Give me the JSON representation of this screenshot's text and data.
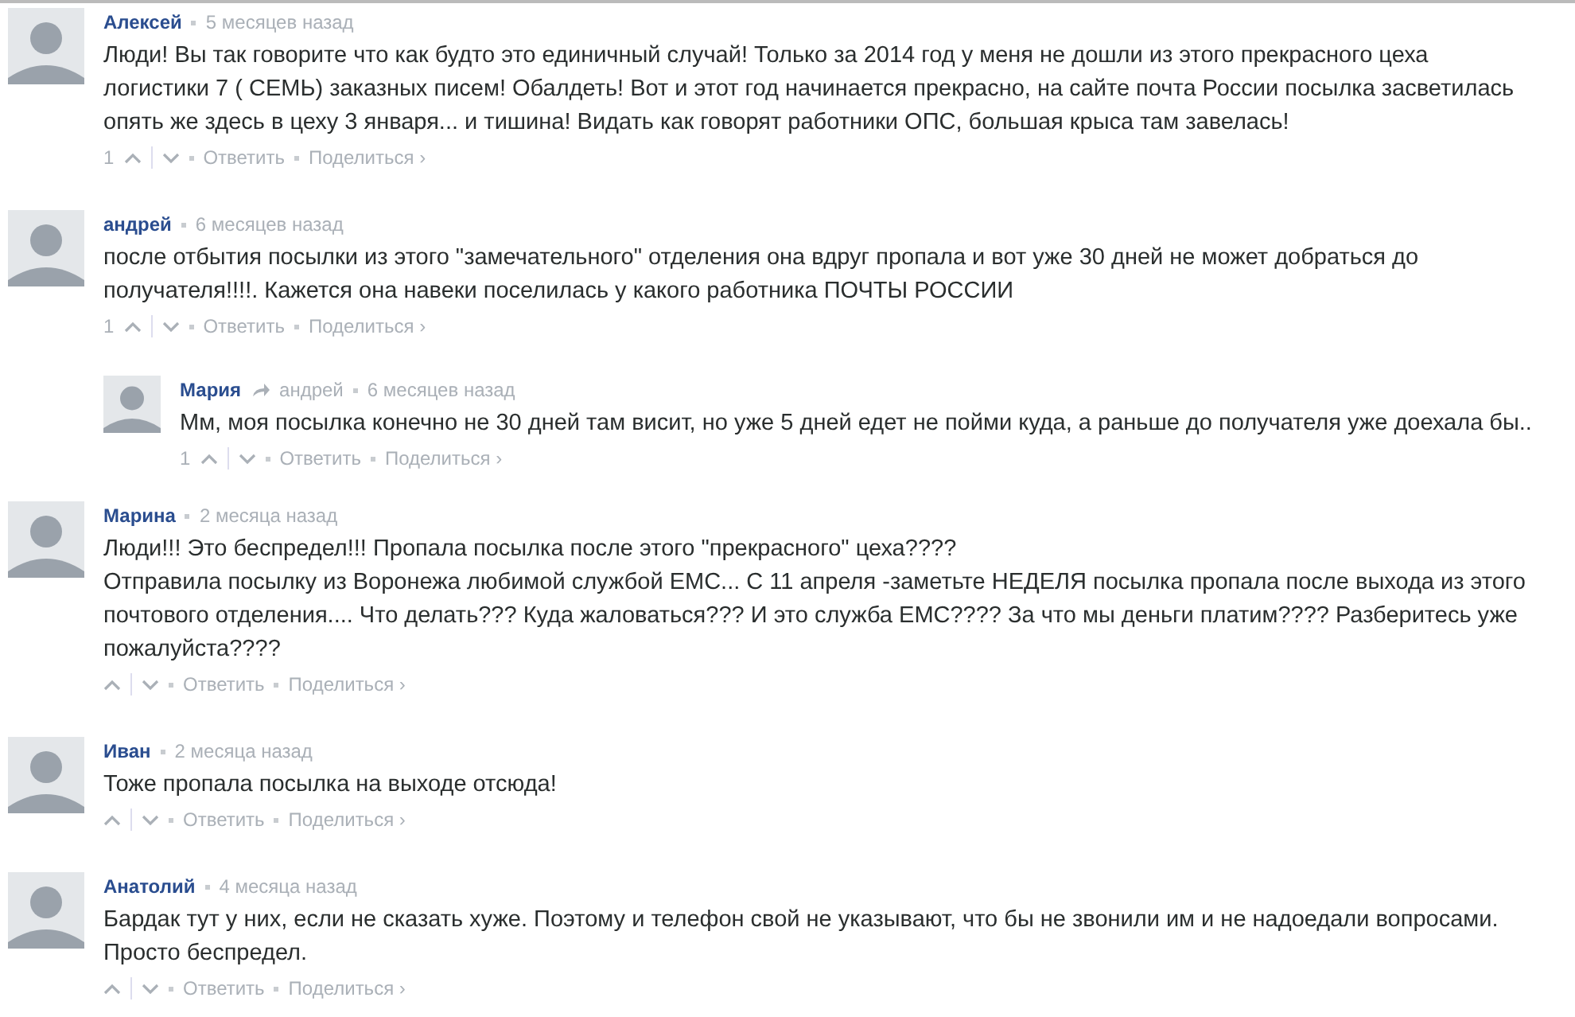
{
  "comments": [
    {
      "author": "Алексей",
      "time": "5 месяцев назад",
      "lines": [
        "Люди! Вы так говорите что как будто это единичный случай! Только за 2014 год у меня не дошли из этого прекрасного цеха",
        "логистики 7 ( СЕМЬ) заказных писем! Обалдеть! Вот и этот год начинается прекрасно, на сайте почта России посылка засветилась",
        "опять же здесь в цеху 3 января... и тишина! Видать как говорят работники ОПС, большая крыса там завелась!"
      ],
      "votes": "1",
      "reply_label": "Ответить",
      "share_label": "Поделиться ›"
    },
    {
      "author": "андрей",
      "time": "6 месяцев назад",
      "lines": [
        "после отбытия посылки из этого \"замечательного\" отделения она вдруг пропала и вот уже 30 дней не может добраться до",
        "получателя!!!!. Кажется она навеки поселилась у какого работника ПОЧТЫ РОССИИ"
      ],
      "votes": "1",
      "reply_label": "Ответить",
      "share_label": "Поделиться ›",
      "children": [
        {
          "author": "Мария",
          "reply_to": "андрей",
          "time": "6 месяцев назад",
          "lines": [
            "Мм, моя посылка конечно не 30 дней там висит, но уже 5 дней едет не пойми куда, а раньше до получателя уже доехала бы.."
          ],
          "votes": "1",
          "reply_label": "Ответить",
          "share_label": "Поделиться ›"
        }
      ]
    },
    {
      "author": "Марина",
      "time": "2 месяца назад",
      "lines": [
        "Люди!!! Это беспредел!!! Пропала посылка после этого \"прекрасного\" цеха????",
        "Отправила посылку из Воронежа любимой службой ЕМС... С 11 апреля -заметьте НЕДЕЛЯ посылка пропала после выхода из этого",
        "почтового отделения.... Что делать??? Куда жаловаться??? И это служба ЕМС???? За что мы деньги платим???? Разберитесь уже",
        "пожалуйста????"
      ],
      "reply_label": "Ответить",
      "share_label": "Поделиться ›"
    },
    {
      "author": "Иван",
      "time": "2 месяца назад",
      "lines": [
        "Тоже пропала посылка на выходе отсюда!"
      ],
      "reply_label": "Ответить",
      "share_label": "Поделиться ›"
    },
    {
      "author": "Анатолий",
      "time": "4 месяца назад",
      "lines": [
        "Бардак тут у них, если не сказать хуже. Поэтому и телефон свой не указывают, что бы не звонили им и не надоедали вопросами.",
        "Просто беспредел."
      ],
      "reply_label": "Ответить",
      "share_label": "Поделиться ›"
    }
  ]
}
